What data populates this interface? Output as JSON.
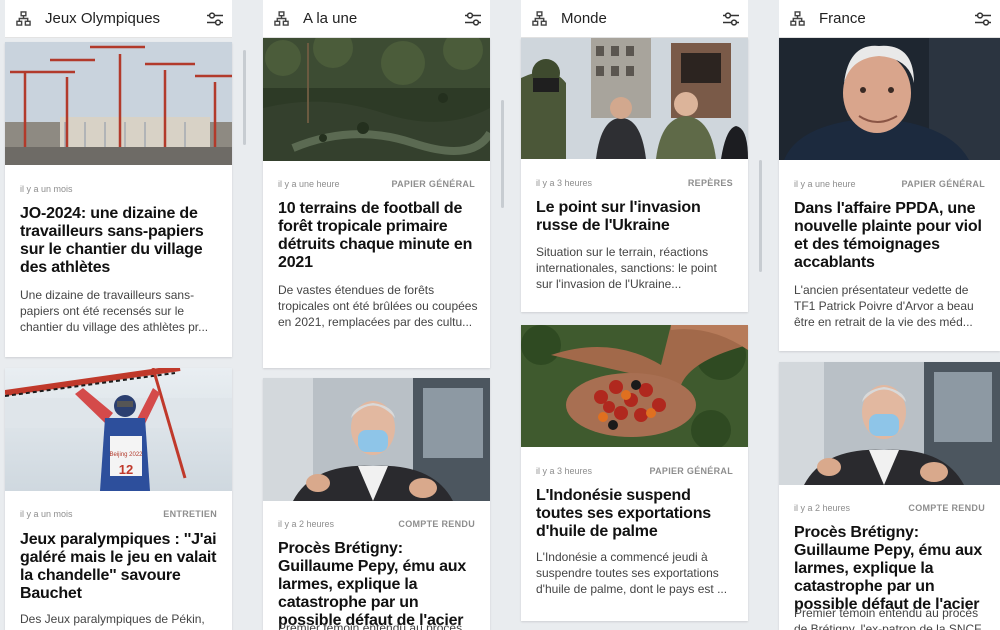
{
  "columns": [
    {
      "title": "Jeux Olympiques",
      "cards": [
        {
          "time": "il y a un mois",
          "tag": "",
          "headline": "JO-2024: une dizaine de travailleurs sans-papiers sur le chantier du village des athlètes",
          "summary": "Une dizaine de travailleurs sans-papiers ont été recensés sur le chantier du village des athlètes pr..."
        },
        {
          "time": "il y a un mois",
          "tag": "ENTRETIEN",
          "headline": "Jeux paralympiques : ''J'ai galéré mais le jeu en valait la chandelle'' savoure Bauchet",
          "summary": "Des Jeux paralympiques de Pékin,",
          "bib_number": "12",
          "bib_text": "Beijing 2022"
        }
      ]
    },
    {
      "title": "A la une",
      "cards": [
        {
          "time": "il y a une heure",
          "tag": "PAPIER GÉNÉRAL",
          "headline": "10 terrains de football de forêt tropicale primaire détruits chaque minute en 2021",
          "summary": "De vastes étendues de forêts tropicales ont été brûlées ou coupées en 2021, remplacées par des cultu..."
        },
        {
          "time": "il y a 2 heures",
          "tag": "COMPTE RENDU",
          "headline": "Procès Brétigny: Guillaume Pepy, ému aux larmes, explique la catastrophe par un possible défaut de l'acier",
          "summary": "Premier témoin entendu au procès"
        }
      ]
    },
    {
      "title": "Monde",
      "cards": [
        {
          "time": "il y a 3 heures",
          "tag": "REPÈRES",
          "headline": "Le point sur l'invasion russe de l'Ukraine",
          "summary": "Situation sur le terrain, réactions internationales, sanctions: le point sur l'invasion de l'Ukraine..."
        },
        {
          "time": "il y a 3 heures",
          "tag": "PAPIER GÉNÉRAL",
          "headline": "L'Indonésie suspend toutes ses exportations d'huile de palme",
          "summary": "L'Indonésie a commencé jeudi à suspendre toutes ses exportations d'huile de palme, dont le pays est ..."
        }
      ]
    },
    {
      "title": "France",
      "cards": [
        {
          "time": "il y a une heure",
          "tag": "PAPIER GÉNÉRAL",
          "headline": "Dans l'affaire PPDA, une nouvelle plainte pour viol et des témoignages accablants",
          "summary": "L'ancien présentateur vedette de TF1 Patrick Poivre d'Arvor a beau être en retrait de la vie des méd..."
        },
        {
          "time": "il y a 2 heures",
          "tag": "COMPTE RENDU",
          "headline": "Procès Brétigny: Guillaume Pepy, ému aux larmes, explique la catastrophe par un possible défaut de l'acier",
          "summary": "Premier témoin entendu au procès de Brétigny, l'ex-patron de la SNCF"
        }
      ]
    }
  ],
  "colors": {
    "background": "#e9ecef",
    "card": "#ffffff",
    "meta": "#8e8e8e",
    "headline": "#111111",
    "summary": "#444444"
  },
  "icons": {
    "column_feed": "sitemap-icon",
    "column_settings": "sliders-icon"
  }
}
